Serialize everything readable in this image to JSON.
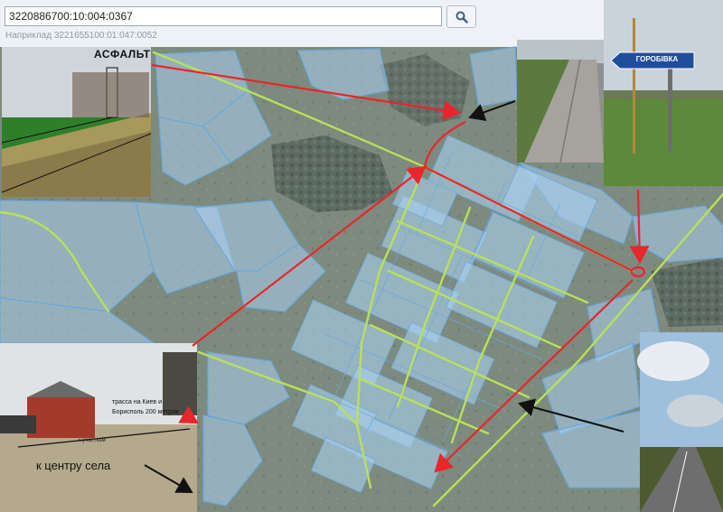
{
  "search": {
    "value": "3220886700:10:004:0367",
    "hint": "Наприклад 3221655100:01:047:0052",
    "button_icon": "search-icon"
  },
  "map": {
    "background_color": "#7b8a7c",
    "parcel_fill": "#a9d0ef",
    "parcel_stroke": "#6aa8da",
    "road_color": "#b9e05a",
    "arrow_red": "#e8262b",
    "arrow_black": "#111111"
  },
  "photos": {
    "asphalt_label": "АСФАЛЬТ",
    "sign_label": "ГОРОБІВКА",
    "road_note": "трасса на Киев и Борисполь 200 метров",
    "small_note": "к участкам",
    "center_label": "к центру села"
  }
}
